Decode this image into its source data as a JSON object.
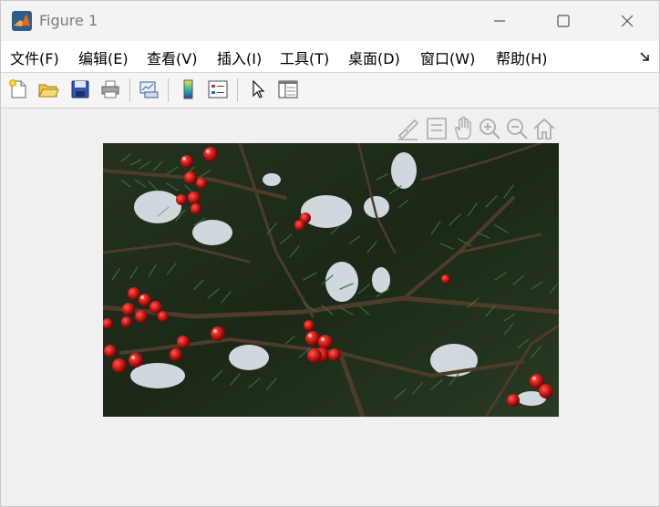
{
  "window": {
    "title": "Figure 1"
  },
  "menu": {
    "items": [
      {
        "label": "文件(F)"
      },
      {
        "label": "编辑(E)"
      },
      {
        "label": "查看(V)"
      },
      {
        "label": "插入(I)"
      },
      {
        "label": "工具(T)"
      },
      {
        "label": "桌面(D)"
      },
      {
        "label": "窗口(W)"
      },
      {
        "label": "帮助(H)"
      }
    ]
  },
  "toolbar": {
    "icons": [
      "new-figure-icon",
      "open-file-icon",
      "save-icon",
      "print-icon",
      "link-plot-icon",
      "insert-colorbar-icon",
      "insert-legend-icon",
      "edit-plot-arrow-icon",
      "property-inspector-icon"
    ]
  },
  "axes_toolbar": {
    "icons": [
      "brush-icon",
      "data-tips-icon",
      "pan-hand-icon",
      "zoom-in-icon",
      "zoom-out-icon",
      "restore-view-home-icon"
    ]
  },
  "figure_image": {
    "subject": "holly-berries-evergreen-branches-snow"
  }
}
